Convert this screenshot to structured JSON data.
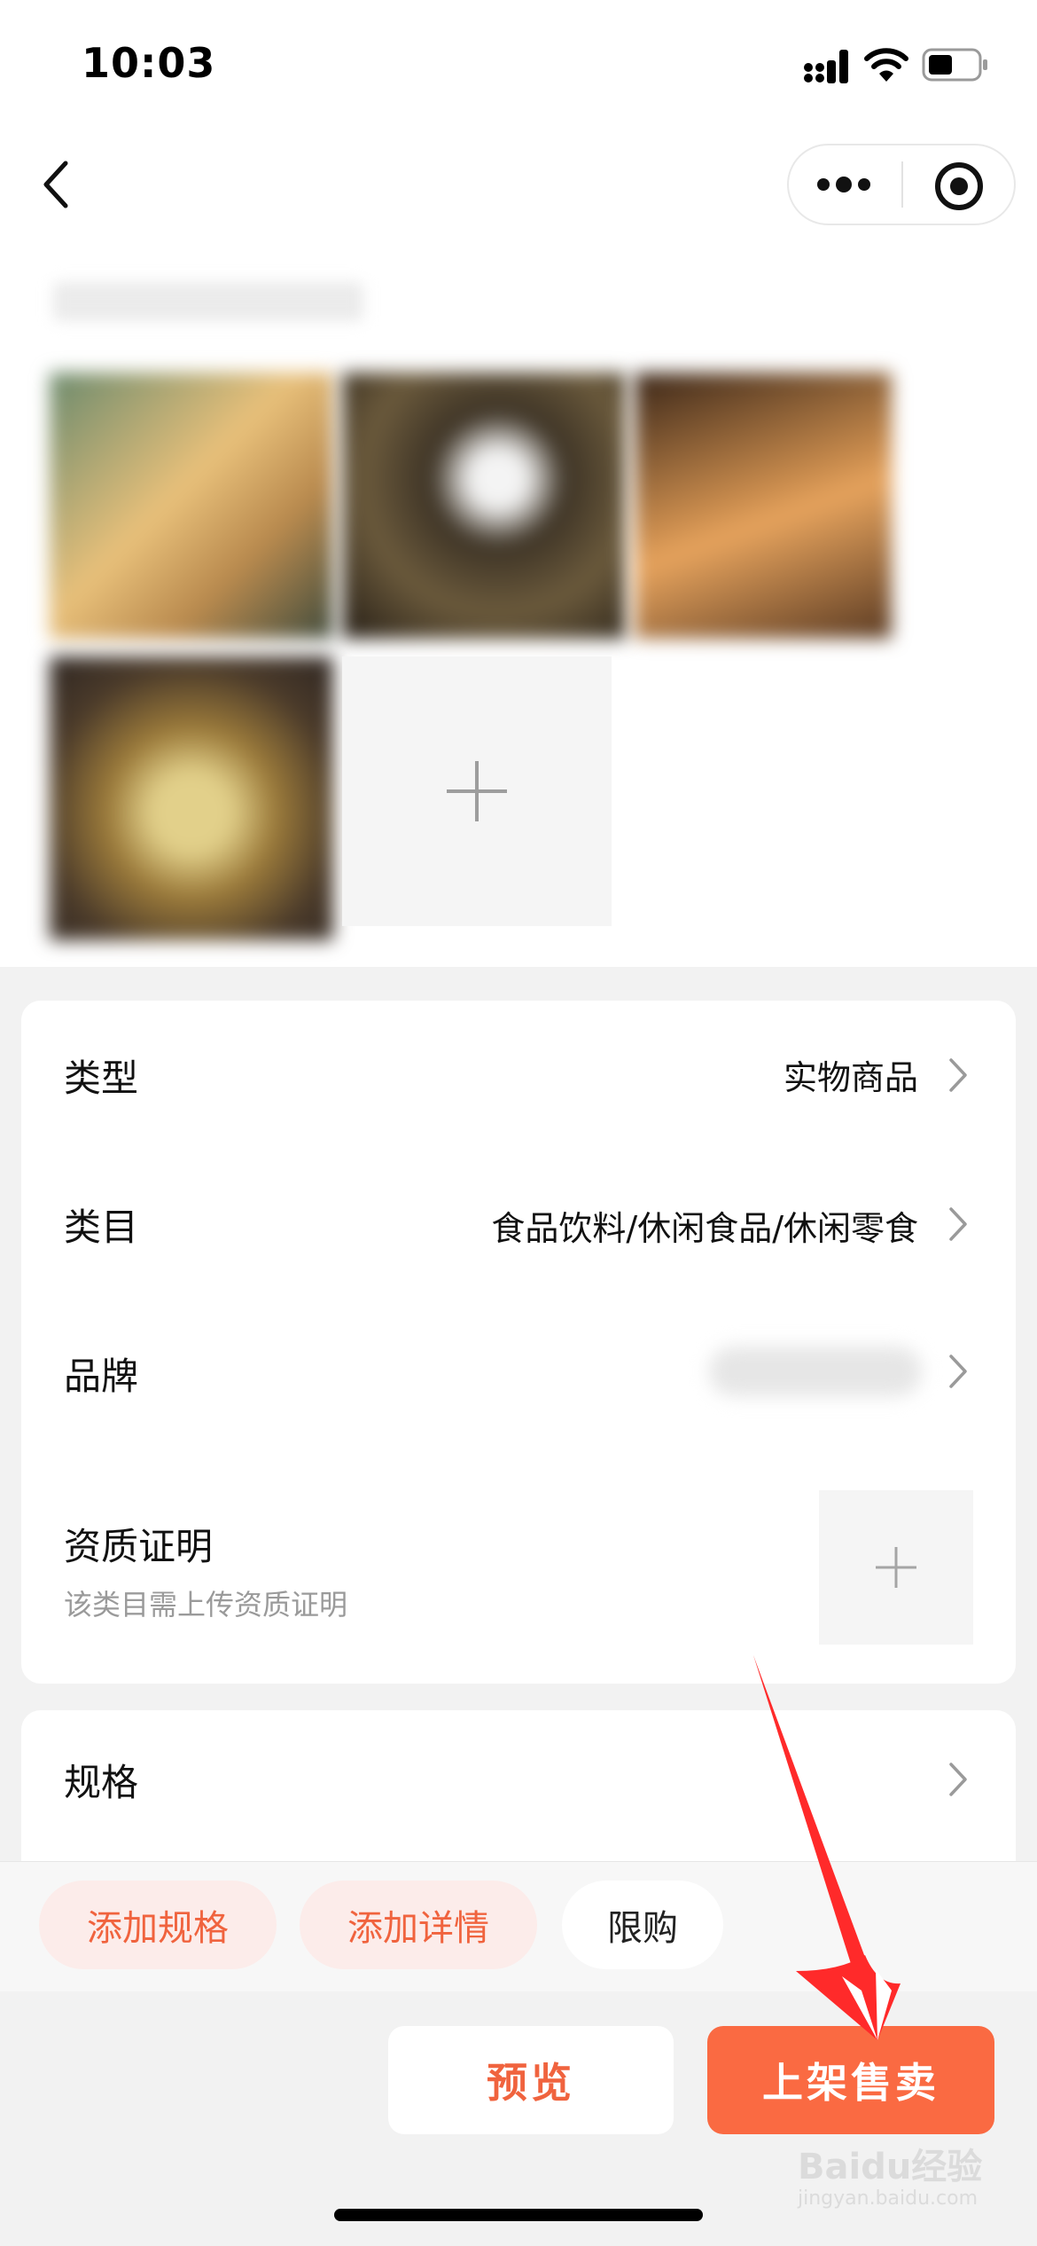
{
  "status_bar": {
    "time": "10:03"
  },
  "nav": {
    "back_icon": "chevron-left-icon",
    "more_icon": "more-dots-icon",
    "close_icon": "target-circle-icon"
  },
  "images": {
    "add_icon": "plus-icon"
  },
  "info": {
    "rows": [
      {
        "label": "类型",
        "value": "实物商品"
      },
      {
        "label": "类目",
        "value": "食品饮料/休闲食品/休闲零食"
      },
      {
        "label": "品牌",
        "value": ""
      }
    ],
    "certificate": {
      "label": "资质证明",
      "hint": "该类目需上传资质证明"
    }
  },
  "spec": {
    "label": "规格"
  },
  "quick_actions": {
    "add_spec": "添加规格",
    "add_detail": "添加详情",
    "limit": "限购"
  },
  "actions": {
    "preview": "预览",
    "publish": "上架售卖"
  },
  "watermark": {
    "text": "Baidu经验",
    "sub": "jingyan.baidu.com"
  },
  "colors": {
    "accent": "#fa6a42",
    "accent_text": "#f0633e",
    "annotation": "#ff2a2a"
  }
}
